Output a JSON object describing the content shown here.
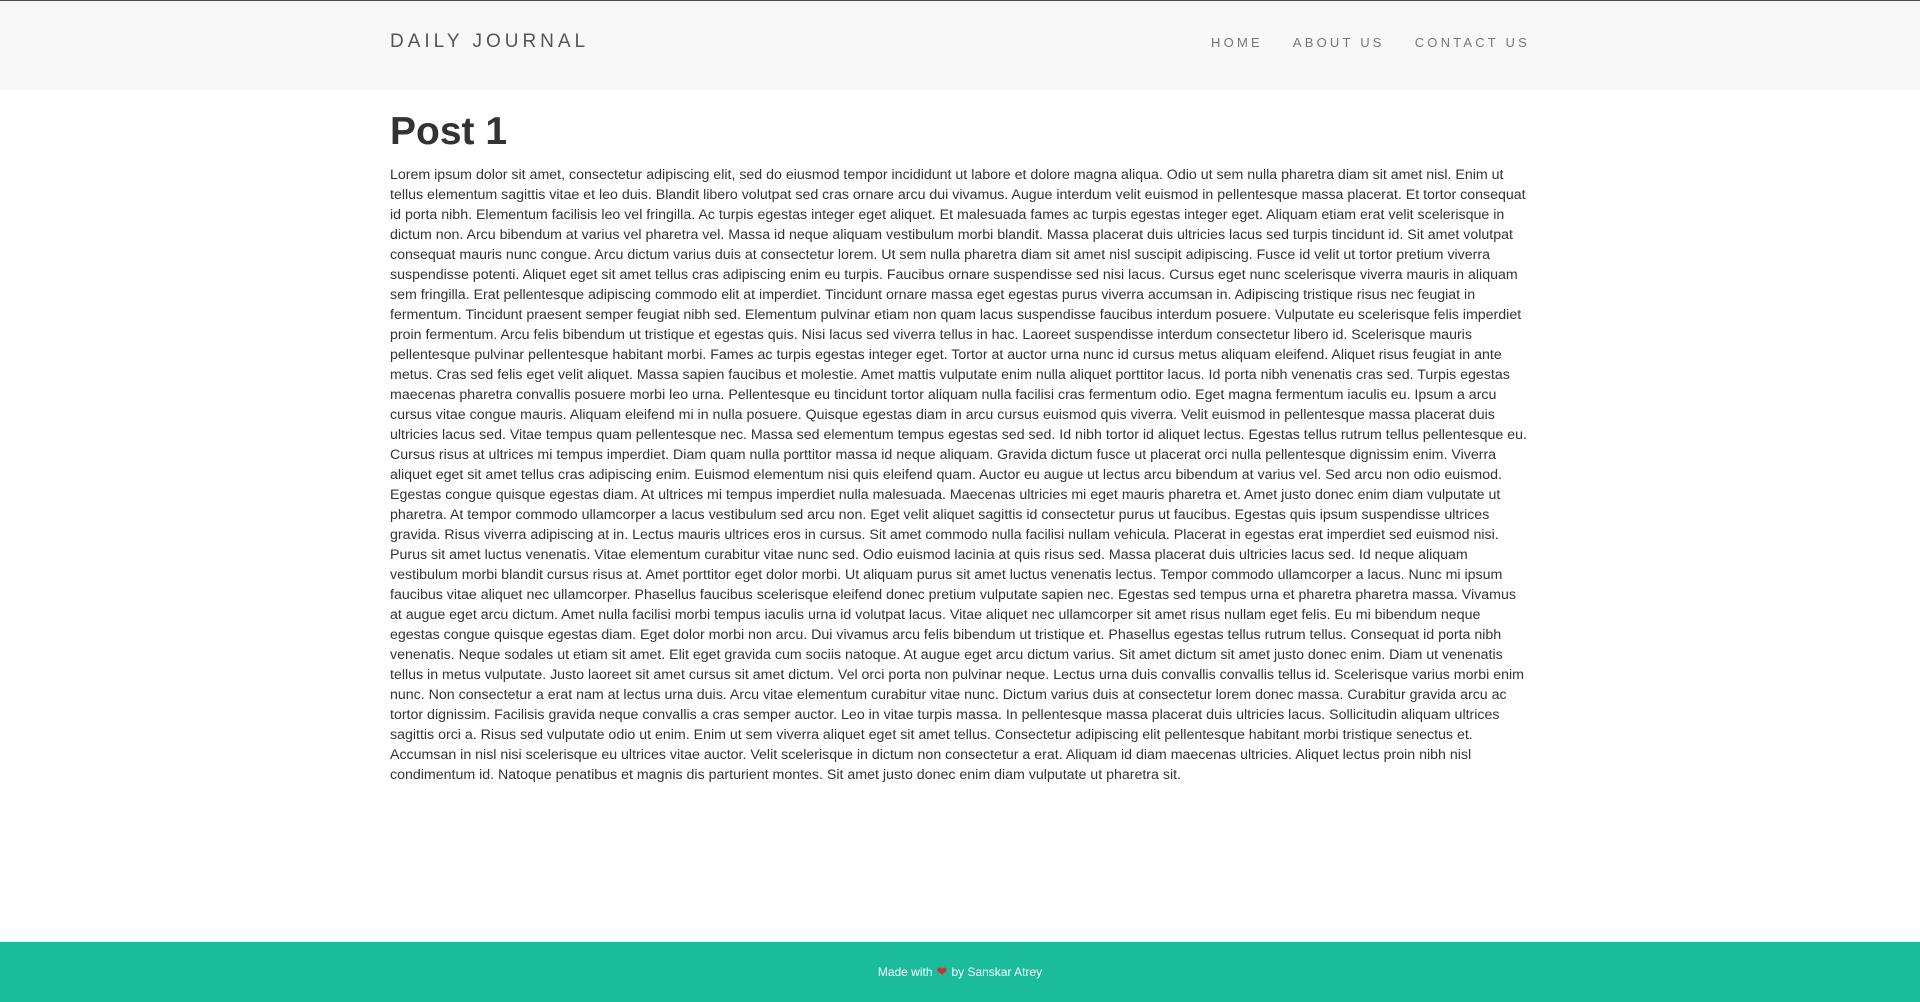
{
  "navbar": {
    "brand": "DAILY JOURNAL",
    "links": [
      "HOME",
      "ABOUT US",
      "CONTACT US"
    ]
  },
  "post": {
    "title": "Post 1",
    "body": "Lorem ipsum dolor sit amet, consectetur adipiscing elit, sed do eiusmod tempor incididunt ut labore et dolore magna aliqua. Odio ut sem nulla pharetra diam sit amet nisl. Enim ut tellus elementum sagittis vitae et leo duis. Blandit libero volutpat sed cras ornare arcu dui vivamus. Augue interdum velit euismod in pellentesque massa placerat. Et tortor consequat id porta nibh. Elementum facilisis leo vel fringilla. Ac turpis egestas integer eget aliquet. Et malesuada fames ac turpis egestas integer eget. Aliquam etiam erat velit scelerisque in dictum non. Arcu bibendum at varius vel pharetra vel. Massa id neque aliquam vestibulum morbi blandit. Massa placerat duis ultricies lacus sed turpis tincidunt id. Sit amet volutpat consequat mauris nunc congue. Arcu dictum varius duis at consectetur lorem. Ut sem nulla pharetra diam sit amet nisl suscipit adipiscing. Fusce id velit ut tortor pretium viverra suspendisse potenti. Aliquet eget sit amet tellus cras adipiscing enim eu turpis. Faucibus ornare suspendisse sed nisi lacus. Cursus eget nunc scelerisque viverra mauris in aliquam sem fringilla. Erat pellentesque adipiscing commodo elit at imperdiet. Tincidunt ornare massa eget egestas purus viverra accumsan in. Adipiscing tristique risus nec feugiat in fermentum. Tincidunt praesent semper feugiat nibh sed. Elementum pulvinar etiam non quam lacus suspendisse faucibus interdum posuere. Vulputate eu scelerisque felis imperdiet proin fermentum. Arcu felis bibendum ut tristique et egestas quis. Nisi lacus sed viverra tellus in hac. Laoreet suspendisse interdum consectetur libero id. Scelerisque mauris pellentesque pulvinar pellentesque habitant morbi. Fames ac turpis egestas integer eget. Tortor at auctor urna nunc id cursus metus aliquam eleifend. Aliquet risus feugiat in ante metus. Cras sed felis eget velit aliquet. Massa sapien faucibus et molestie. Amet mattis vulputate enim nulla aliquet porttitor lacus. Id porta nibh venenatis cras sed. Turpis egestas maecenas pharetra convallis posuere morbi leo urna. Pellentesque eu tincidunt tortor aliquam nulla facilisi cras fermentum odio. Eget magna fermentum iaculis eu. Ipsum a arcu cursus vitae congue mauris. Aliquam eleifend mi in nulla posuere. Quisque egestas diam in arcu cursus euismod quis viverra. Velit euismod in pellentesque massa placerat duis ultricies lacus sed. Vitae tempus quam pellentesque nec. Massa sed elementum tempus egestas sed sed. Id nibh tortor id aliquet lectus. Egestas tellus rutrum tellus pellentesque eu. Cursus risus at ultrices mi tempus imperdiet. Diam quam nulla porttitor massa id neque aliquam. Gravida dictum fusce ut placerat orci nulla pellentesque dignissim enim. Viverra aliquet eget sit amet tellus cras adipiscing enim. Euismod elementum nisi quis eleifend quam. Auctor eu augue ut lectus arcu bibendum at varius vel. Sed arcu non odio euismod. Egestas congue quisque egestas diam. At ultrices mi tempus imperdiet nulla malesuada. Maecenas ultricies mi eget mauris pharetra et. Amet justo donec enim diam vulputate ut pharetra. At tempor commodo ullamcorper a lacus vestibulum sed arcu non. Eget velit aliquet sagittis id consectetur purus ut faucibus. Egestas quis ipsum suspendisse ultrices gravida. Risus viverra adipiscing at in. Lectus mauris ultrices eros in cursus. Sit amet commodo nulla facilisi nullam vehicula. Placerat in egestas erat imperdiet sed euismod nisi. Purus sit amet luctus venenatis. Vitae elementum curabitur vitae nunc sed. Odio euismod lacinia at quis risus sed. Massa placerat duis ultricies lacus sed. Id neque aliquam vestibulum morbi blandit cursus risus at. Amet porttitor eget dolor morbi. Ut aliquam purus sit amet luctus venenatis lectus. Tempor commodo ullamcorper a lacus. Nunc mi ipsum faucibus vitae aliquet nec ullamcorper. Phasellus faucibus scelerisque eleifend donec pretium vulputate sapien nec. Egestas sed tempus urna et pharetra pharetra massa. Vivamus at augue eget arcu dictum. Amet nulla facilisi morbi tempus iaculis urna id volutpat lacus. Vitae aliquet nec ullamcorper sit amet risus nullam eget felis. Eu mi bibendum neque egestas congue quisque egestas diam. Eget dolor morbi non arcu. Dui vivamus arcu felis bibendum ut tristique et. Phasellus egestas tellus rutrum tellus. Consequat id porta nibh venenatis. Neque sodales ut etiam sit amet. Elit eget gravida cum sociis natoque. At augue eget arcu dictum varius. Sit amet dictum sit amet justo donec enim. Diam ut venenatis tellus in metus vulputate. Justo laoreet sit amet cursus sit amet dictum. Vel orci porta non pulvinar neque. Lectus urna duis convallis convallis tellus id. Scelerisque varius morbi enim nunc. Non consectetur a erat nam at lectus urna duis. Arcu vitae elementum curabitur vitae nunc. Dictum varius duis at consectetur lorem donec massa. Curabitur gravida arcu ac tortor dignissim. Facilisis gravida neque convallis a cras semper auctor. Leo in vitae turpis massa. In pellentesque massa placerat duis ultricies lacus. Sollicitudin aliquam ultrices sagittis orci a. Risus sed vulputate odio ut enim. Enim ut sem viverra aliquet eget sit amet tellus. Consectetur adipiscing elit pellentesque habitant morbi tristique senectus et. Accumsan in nisl nisi scelerisque eu ultrices vitae auctor. Velit scelerisque in dictum non consectetur a erat. Aliquam id diam maecenas ultricies. Aliquet lectus proin nibh nisl condimentum id. Natoque penatibus et magnis dis parturient montes. Sit amet justo donec enim diam vulputate ut pharetra sit."
  },
  "footer": {
    "prefix": "Made with",
    "heart_icon": "heart-icon",
    "suffix": "by Sanskar Atrey"
  },
  "colors": {
    "navbar_bg": "#f8f8f8",
    "footer_bg": "#1abc9c",
    "heart": "#e3262b"
  }
}
